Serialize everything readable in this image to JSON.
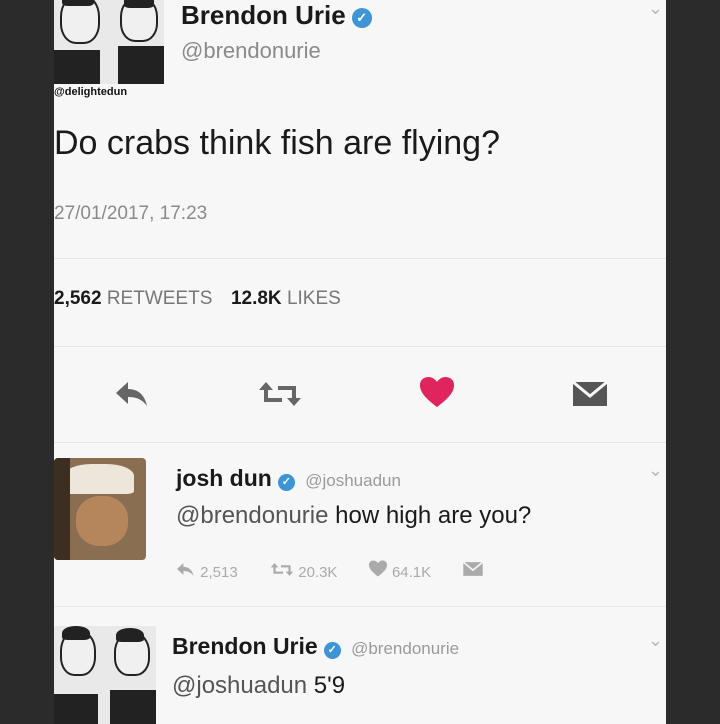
{
  "main_tweet": {
    "author_name": "Brendon Urie",
    "author_handle": "@brendonurie",
    "avatar_caption": "@delightedun",
    "text": "Do crabs think fish are flying?",
    "timestamp": "27/01/2017, 17:23",
    "retweet_count": "2,562",
    "retweet_label": "RETWEETS",
    "like_count": "12.8K",
    "like_label": "LIKES"
  },
  "reply_1": {
    "author_name": "josh dun",
    "author_handle": "@joshuadun",
    "mention": "@brendonurie",
    "text": " how high are you?",
    "reply_count": "2,513",
    "retweet_count": "20.3K",
    "like_count": "64.1K"
  },
  "reply_2": {
    "author_name": "Brendon Urie",
    "author_handle": "@brendonurie",
    "mention": "@joshuadun",
    "text": " 5'9"
  },
  "icons": {
    "verified": "verified-badge-icon",
    "reply": "reply-icon",
    "retweet": "retweet-icon",
    "like": "heart-icon",
    "dm": "direct-message-icon",
    "more": "chevron-down-icon"
  },
  "colors": {
    "like_active": "#e0245e",
    "verified": "#3d95d6",
    "mention": "#555555"
  }
}
